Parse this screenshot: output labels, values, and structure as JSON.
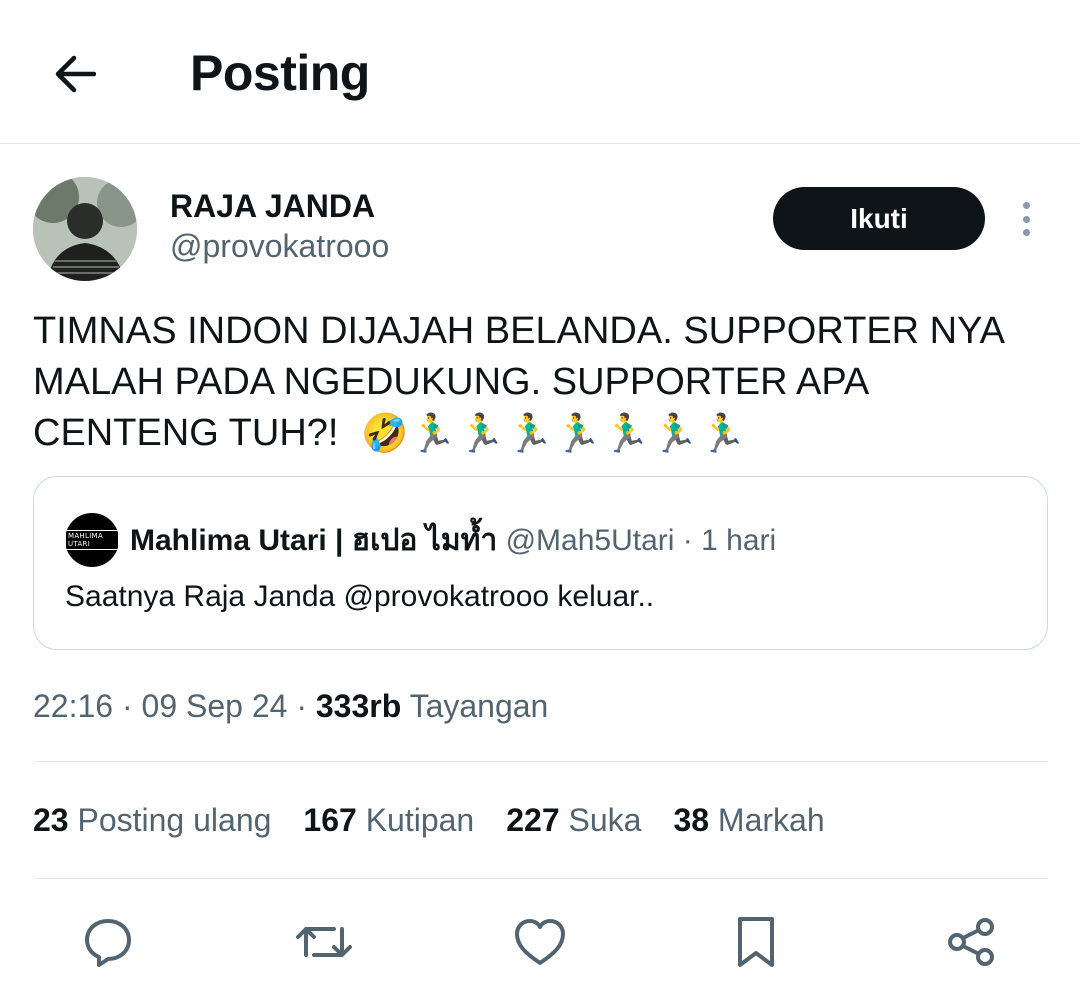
{
  "header": {
    "title": "Posting"
  },
  "author": {
    "name": "RAJA JANDA",
    "handle": "@provokatrooo"
  },
  "follow_label": "Ikuti",
  "tweet": {
    "text": "TIMNAS INDON DIJAJAH BELANDA. SUPPORTER NYA MALAH PADA NGEDUKUNG. SUPPORTER APA CENTENG TUH?!",
    "emoji_laugh": "🤣",
    "emoji_runners": [
      "🏃‍♂️",
      "🏃‍♂️",
      "🏃‍♂️",
      "🏃‍♂️",
      "🏃‍♂️",
      "🏃‍♂️",
      "🏃‍♂️"
    ]
  },
  "quote": {
    "name": "Mahlima Utari | ฮเปอ ไมท้ำ",
    "handle": "@Mah5Utari",
    "dot": "·",
    "time": "1 hari",
    "text": "Saatnya Raja Janda @provokatrooo keluar..",
    "avatar_text": "MAHLIMA UTARI"
  },
  "meta": {
    "time": "22:16",
    "sep1": "·",
    "date": "09 Sep 24",
    "sep2": "·",
    "views": "333rb",
    "views_label": "Tayangan"
  },
  "stats": [
    {
      "num": "23",
      "label": "Posting ulang"
    },
    {
      "num": "167",
      "label": "Kutipan"
    },
    {
      "num": "227",
      "label": "Suka"
    },
    {
      "num": "38",
      "label": "Markah"
    }
  ],
  "actions": [
    "reply-icon",
    "repost-icon",
    "like-icon",
    "bookmark-icon",
    "share-icon"
  ],
  "colors": {
    "text": "#0f1419",
    "secondary": "#536471",
    "border": "#cfd9de",
    "button": "#0f1419"
  }
}
